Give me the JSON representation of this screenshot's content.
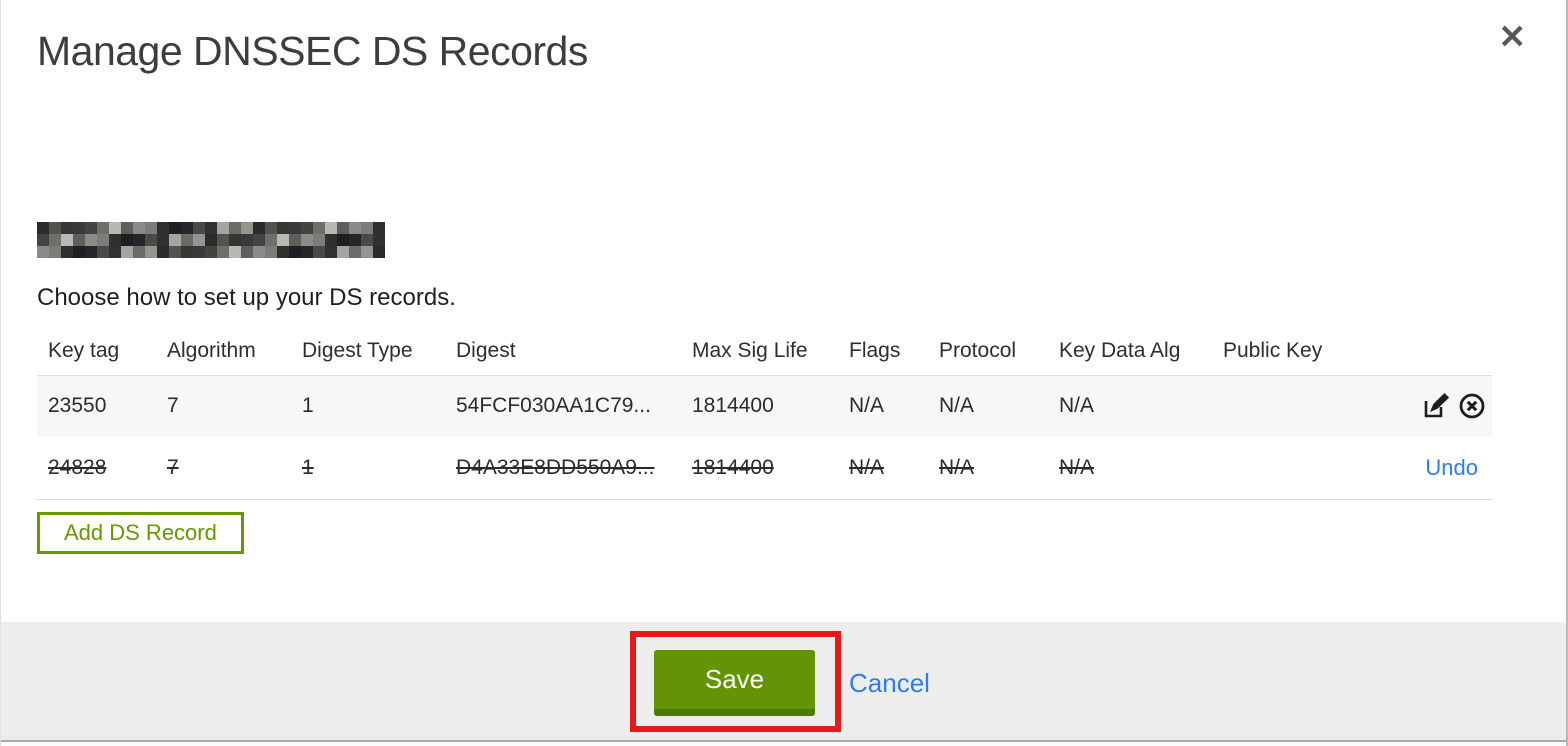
{
  "modal": {
    "title": "Manage DNSSEC DS Records",
    "close_icon_glyph": "✕",
    "subtitle": "Choose how to set up your DS records.",
    "redacted_mosaic_colors": [
      "#2b2b2b",
      "#4a4a48",
      "#8a8a88",
      "#3a3a3c",
      "#6b6a66",
      "#1f1f21",
      "#b9b7b2",
      "#55534f",
      "#2f3134",
      "#7d7c78",
      "#444340",
      "#96948f",
      "#26262a",
      "#5f5e5a",
      "#383634",
      "#a7a5a0",
      "#31302e",
      "#6f6e6a"
    ]
  },
  "table": {
    "headers": [
      "Key tag",
      "Algorithm",
      "Digest Type",
      "Digest",
      "Max Sig Life",
      "Flags",
      "Protocol",
      "Key Data Alg",
      "Public Key"
    ],
    "rows": [
      {
        "key_tag": "23550",
        "algorithm": "7",
        "digest_type": "1",
        "digest": "54FCF030AA1C79...",
        "max_sig_life": "1814400",
        "flags": "N/A",
        "protocol": "N/A",
        "key_data_alg": "N/A",
        "public_key": "",
        "state": "existing"
      },
      {
        "key_tag": "24828",
        "algorithm": "7",
        "digest_type": "1",
        "digest": "D4A33E8DD550A9...",
        "max_sig_life": "1814400",
        "flags": "N/A",
        "protocol": "N/A",
        "key_data_alg": "N/A",
        "public_key": "",
        "state": "deleted",
        "undo_label": "Undo"
      }
    ]
  },
  "buttons": {
    "add_ds_record": "Add DS Record",
    "save": "Save",
    "cancel": "Cancel"
  },
  "colors": {
    "brand_green": "#669900",
    "save_green": "#639405",
    "save_green_dark": "#4e7a03",
    "link_blue": "#2f7cf0",
    "annotation_red": "#e8191d",
    "row_alt_bg": "#f7f7f7",
    "footer_bg": "#ededed"
  }
}
